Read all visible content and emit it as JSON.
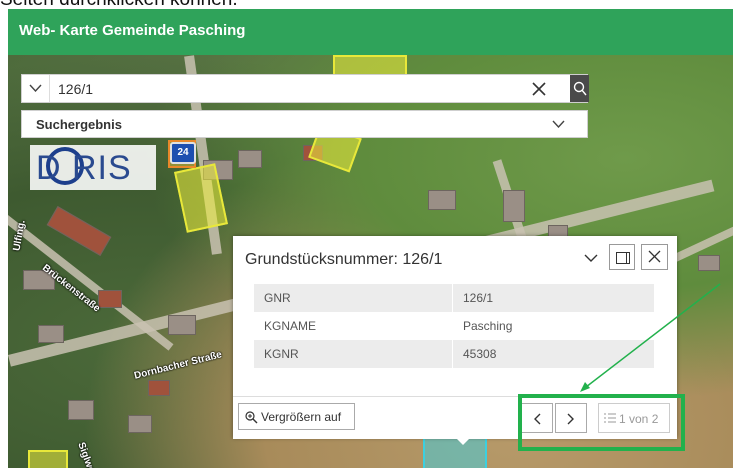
{
  "caption": "Seiten durchklicken können.",
  "app": {
    "title": "Web- Karte Gemeinde Pasching"
  },
  "search": {
    "value": "126/1",
    "result_label": "Suchergebnis"
  },
  "logo": {
    "text": "D RIS"
  },
  "badge": {
    "text": "24"
  },
  "streets": [
    "Brückenstraße",
    "Dornbacher Straße",
    "Siglweg",
    "Ulfing."
  ],
  "popup": {
    "title": "Grundstücksnummer: 126/1",
    "rows": [
      {
        "key": "GNR",
        "value": "126/1"
      },
      {
        "key": "KGNAME",
        "value": "Pasching"
      },
      {
        "key": "KGNR",
        "value": "45308"
      }
    ],
    "zoom_label": "Vergrößern auf",
    "pager_text": "1 von 2"
  },
  "colors": {
    "appbar": "#2fa35a",
    "highlight": "#22b14c",
    "parcel_yellow": "#e8e83a",
    "logo_blue": "#1d3f8c"
  }
}
